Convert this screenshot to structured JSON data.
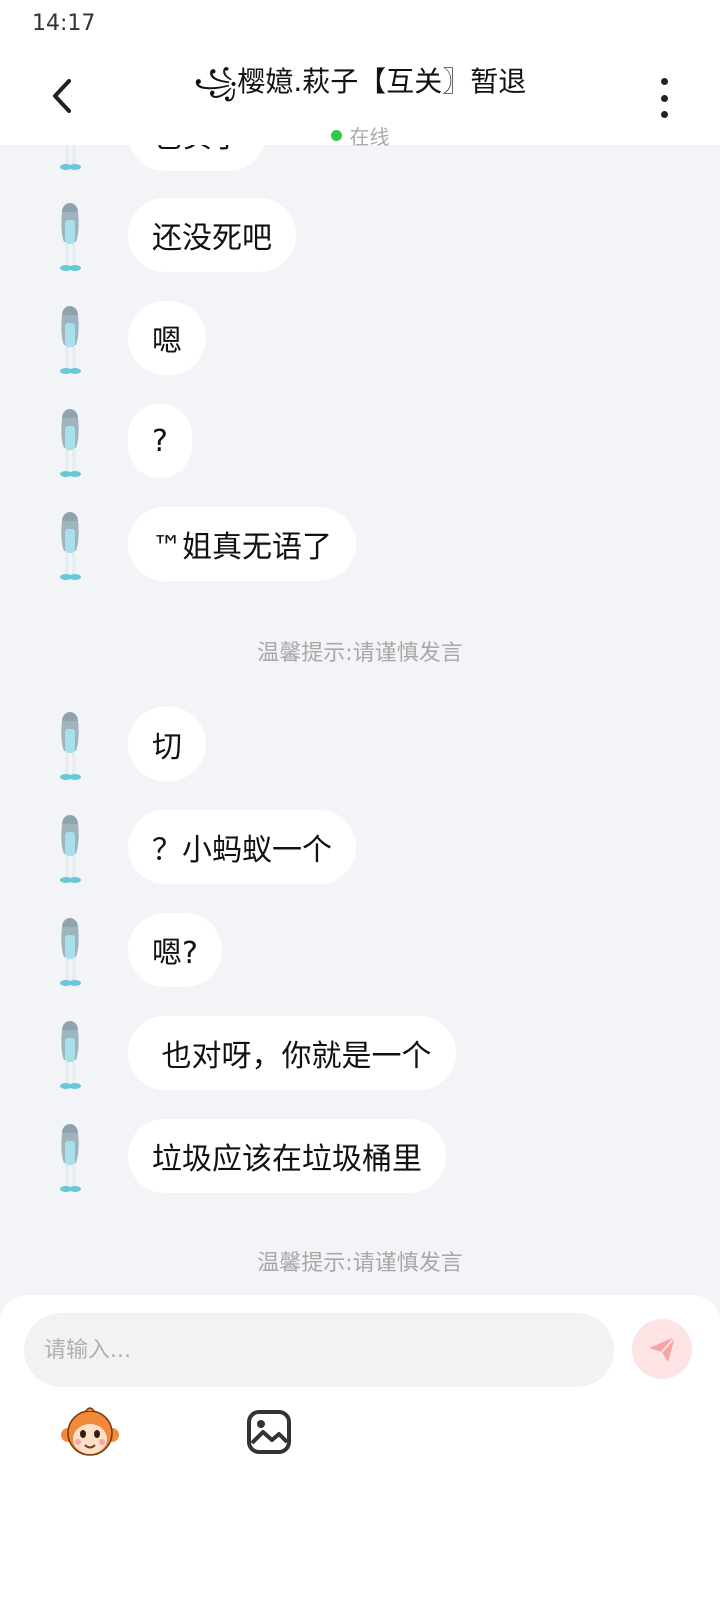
{
  "status_bar": {
    "time": "14:17"
  },
  "header": {
    "title": "꧁樱嬑.萩子【互关〗暂退",
    "status": "在线"
  },
  "chat": {
    "partial_top": "也实了",
    "messages_a": [
      {
        "text": "还没死吧"
      },
      {
        "text": "嗯"
      },
      {
        "text": "?"
      },
      {
        "text": "™姐真无语了"
      }
    ],
    "tip_1": "温馨提示:请谨慎发言",
    "messages_b": [
      {
        "text": "切"
      },
      {
        "text": "？小蚂蚁一个"
      },
      {
        "text": "嗯?"
      },
      {
        "text": " 也对呀，你就是一个"
      },
      {
        "text": "垃圾应该在垃圾桶里"
      }
    ],
    "tip_2": "温馨提示:请谨慎发言"
  },
  "input": {
    "placeholder": "请输入..."
  },
  "icons": {
    "back": "chevron-left-icon",
    "more": "more-vertical-icon",
    "send": "paper-plane-icon",
    "emoji": "monkey-emoji-icon",
    "image": "image-icon"
  },
  "colors": {
    "online": "#32c84a",
    "send_bg": "#fde3e3",
    "send_icon": "#f5a3a3",
    "chat_bg": "#f3f4f7"
  }
}
